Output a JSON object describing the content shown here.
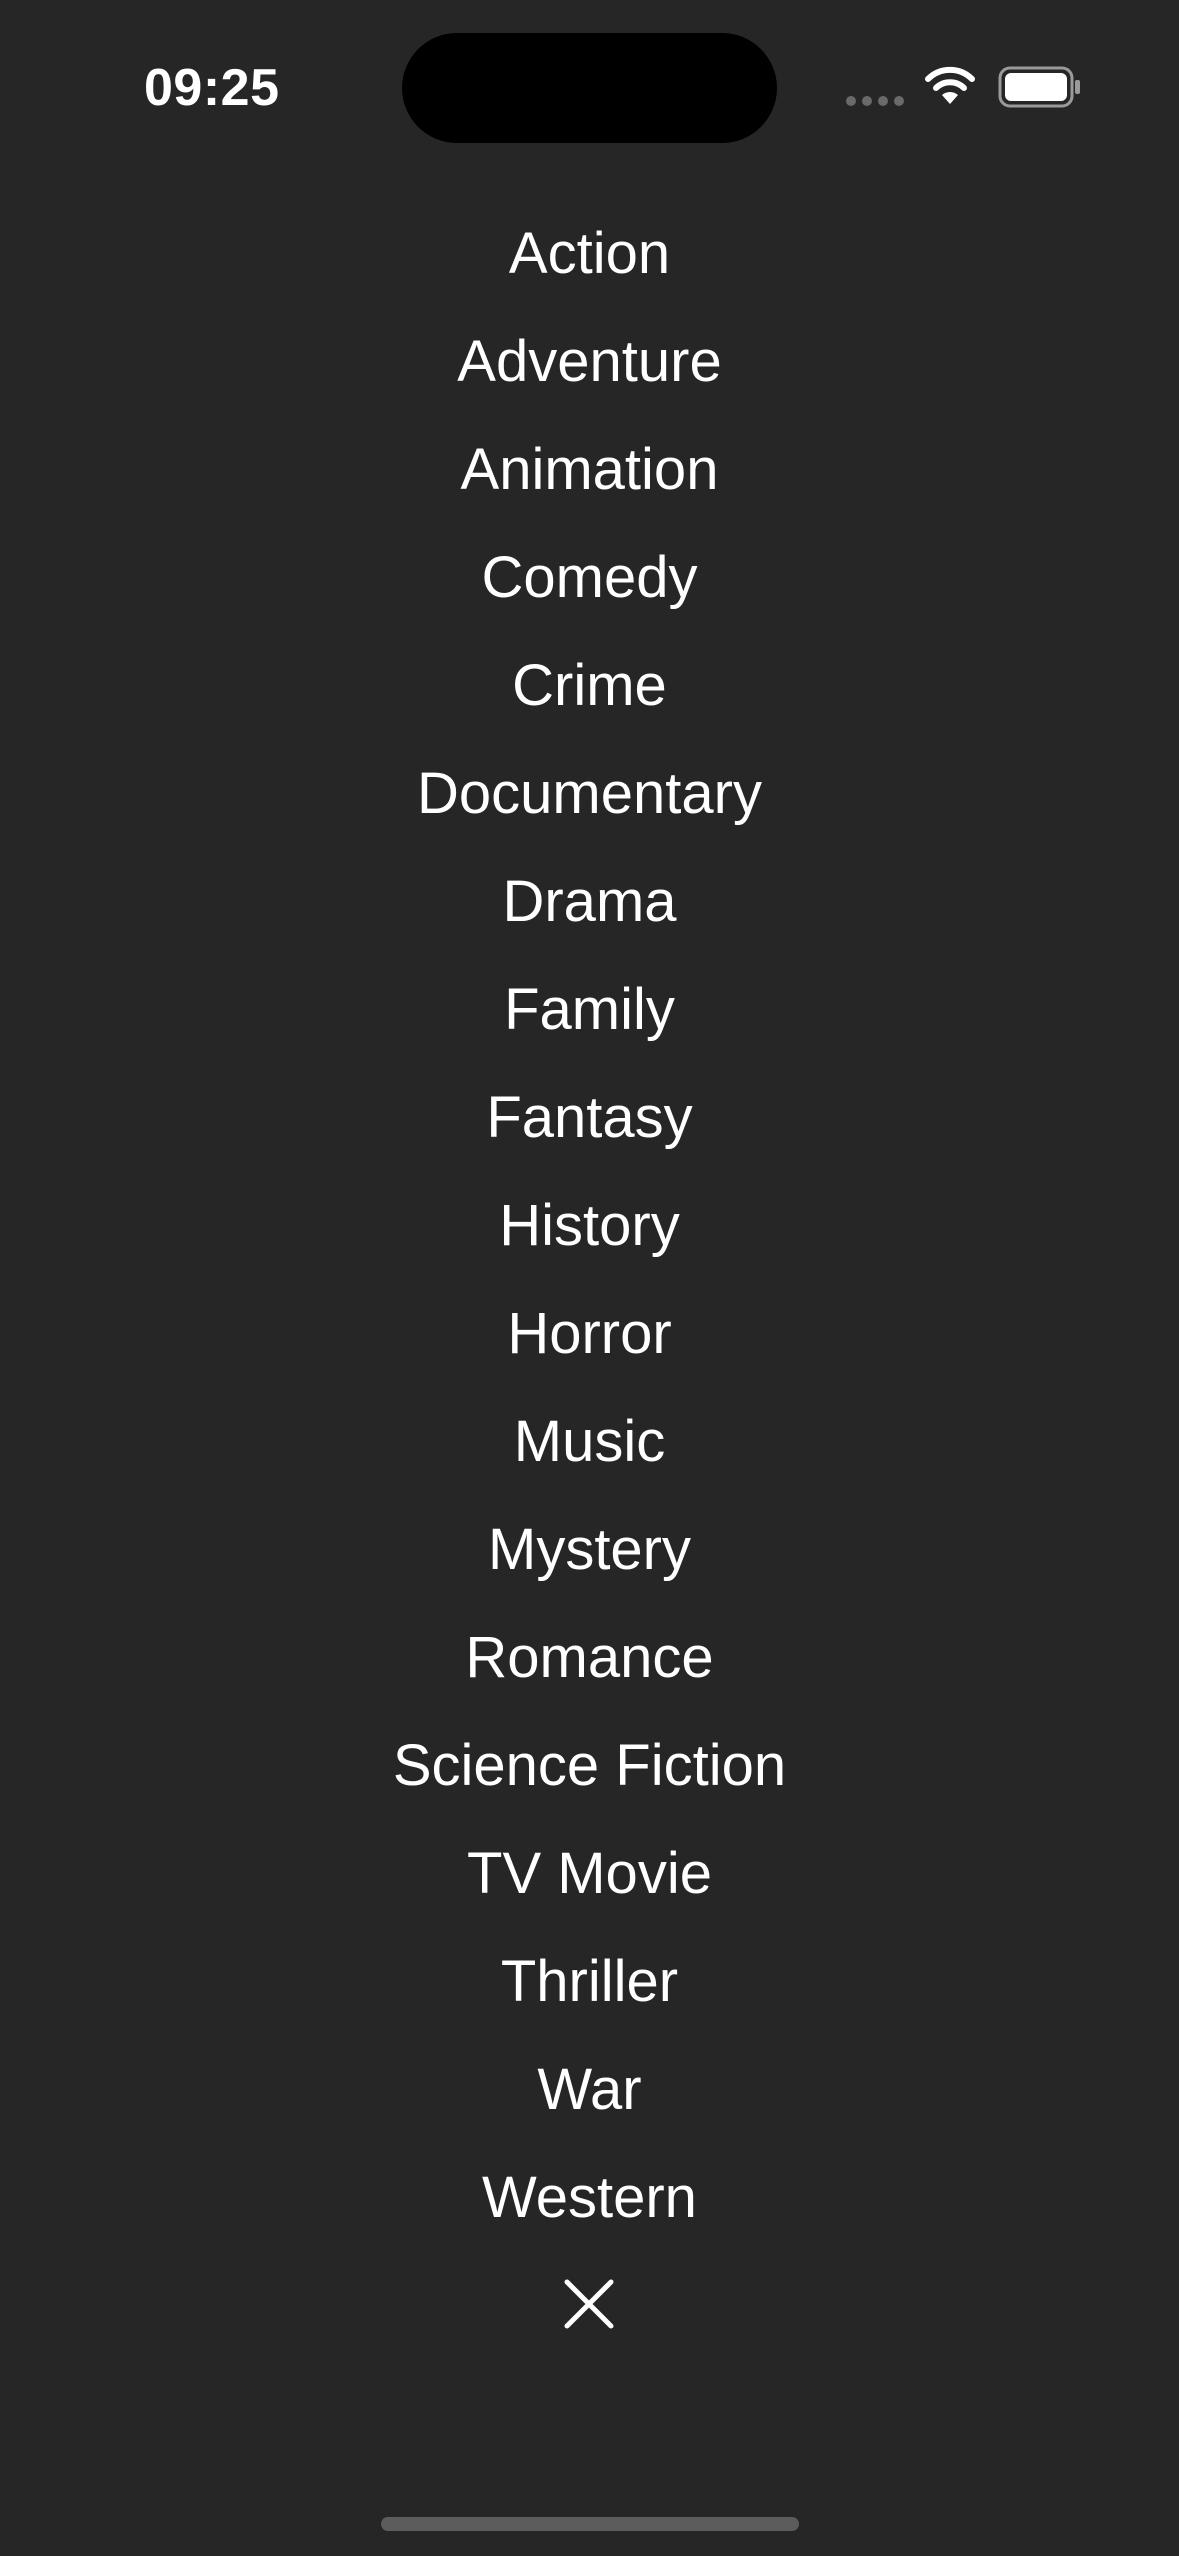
{
  "status_bar": {
    "time": "09:25",
    "icons": [
      "signal-icon",
      "wifi-icon",
      "battery-icon"
    ]
  },
  "genres": [
    "Action",
    "Adventure",
    "Animation",
    "Comedy",
    "Crime",
    "Documentary",
    "Drama",
    "Family",
    "Fantasy",
    "History",
    "Horror",
    "Music",
    "Mystery",
    "Romance",
    "Science Fiction",
    "TV Movie",
    "Thriller",
    "War",
    "Western"
  ],
  "close_icon": "close-icon",
  "colors": {
    "background": "#262626",
    "text": "#ffffff",
    "home_indicator": "#5c5c5c"
  }
}
